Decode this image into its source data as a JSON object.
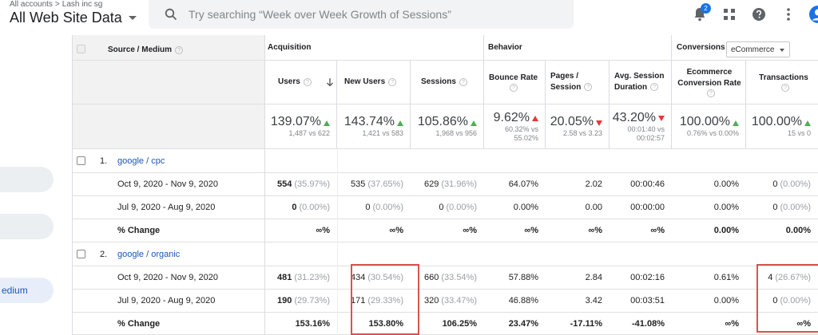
{
  "header": {
    "breadcrumb_accounts": "All accounts",
    "breadcrumb_sep": ">",
    "breadcrumb_property": "Lash inc sg",
    "view_name": "All Web Site Data",
    "search_placeholder": "Try searching “Week over Week Growth of Sessions”",
    "notification_count": "2"
  },
  "leftnav": {
    "active_label": "edium"
  },
  "table": {
    "groups": {
      "acquisition": "Acquisition",
      "behavior": "Behavior",
      "conversions": "Conversions"
    },
    "conversions_select": "eCommerce",
    "col_source": "Source / Medium",
    "columns": {
      "users": "Users",
      "new_users": "New Users",
      "sessions": "Sessions",
      "bounce_1": "Bounce Rate",
      "pages_1": "Pages /",
      "pages_2": "Session",
      "avg_1": "Avg. Session",
      "avg_2": "Duration",
      "ecom_1": "Ecommerce",
      "ecom_2": "Conversion Rate",
      "transactions": "Transactions"
    },
    "totals": {
      "users": {
        "value": "139.07%",
        "sub": "1,487 vs 622"
      },
      "new_users": {
        "value": "143.74%",
        "sub": "1,421 vs 583"
      },
      "sessions": {
        "value": "105.86%",
        "sub": "1,968 vs 956"
      },
      "bounce": {
        "value": "9.62%",
        "sub1": "60.32% vs",
        "sub2": "55.02%"
      },
      "pages": {
        "value": "20.05%",
        "sub": "2.58 vs 3.23"
      },
      "avg": {
        "value": "43.20%",
        "sub1": "00:01:40 vs",
        "sub2": "00:02:57"
      },
      "ecom": {
        "value": "100.00%",
        "sub": "0.76% vs 0.00%"
      },
      "transactions": {
        "value": "100.00%",
        "sub": "15 vs 0"
      }
    },
    "groups_rows": [
      {
        "index": "1.",
        "source": "google / cpc",
        "rows": [
          {
            "label": "Oct 9, 2020 - Nov 9, 2020",
            "users": "554",
            "users_pct": "(35.97%)",
            "new_users": "535",
            "new_users_pct": "(37.65%)",
            "sessions": "629",
            "sessions_pct": "(31.96%)",
            "bounce": "64.07%",
            "pages": "2.02",
            "avg": "00:00:46",
            "ecom": "0.00%",
            "trans": "0",
            "trans_pct": "(0.00%)"
          },
          {
            "label": "Jul 9, 2020 - Aug 9, 2020",
            "users": "0",
            "users_pct": "(0.00%)",
            "new_users": "0",
            "new_users_pct": "(0.00%)",
            "sessions": "0",
            "sessions_pct": "(0.00%)",
            "bounce": "0.00%",
            "pages": "0.00",
            "avg": "00:00:00",
            "ecom": "0.00%",
            "trans": "0",
            "trans_pct": "(0.00%)"
          },
          {
            "label": "% Change",
            "users": "∞%",
            "new_users": "∞%",
            "sessions": "∞%",
            "bounce": "∞%",
            "pages": "∞%",
            "avg": "∞%",
            "ecom": "0.00%",
            "trans": "0.00%"
          }
        ]
      },
      {
        "index": "2.",
        "source": "google / organic",
        "rows": [
          {
            "label": "Oct 9, 2020 - Nov 9, 2020",
            "users": "481",
            "users_pct": "(31.23%)",
            "new_users": "434",
            "new_users_pct": "(30.54%)",
            "sessions": "660",
            "sessions_pct": "(33.54%)",
            "bounce": "57.88%",
            "pages": "2.84",
            "avg": "00:02:16",
            "ecom": "0.61%",
            "trans": "4",
            "trans_pct": "(26.67%)"
          },
          {
            "label": "Jul 9, 2020 - Aug 9, 2020",
            "users": "190",
            "users_pct": "(29.73%)",
            "new_users": "171",
            "new_users_pct": "(29.33%)",
            "sessions": "320",
            "sessions_pct": "(33.47%)",
            "bounce": "46.88%",
            "pages": "3.42",
            "avg": "00:03:51",
            "ecom": "0.00%",
            "trans": "0",
            "trans_pct": "(0.00%)"
          },
          {
            "label": "% Change",
            "users": "153.16%",
            "new_users": "153.80%",
            "sessions": "106.25%",
            "bounce": "23.47%",
            "pages": "-17.11%",
            "avg": "-41.08%",
            "ecom": "∞%",
            "trans": "∞%"
          }
        ]
      }
    ]
  }
}
